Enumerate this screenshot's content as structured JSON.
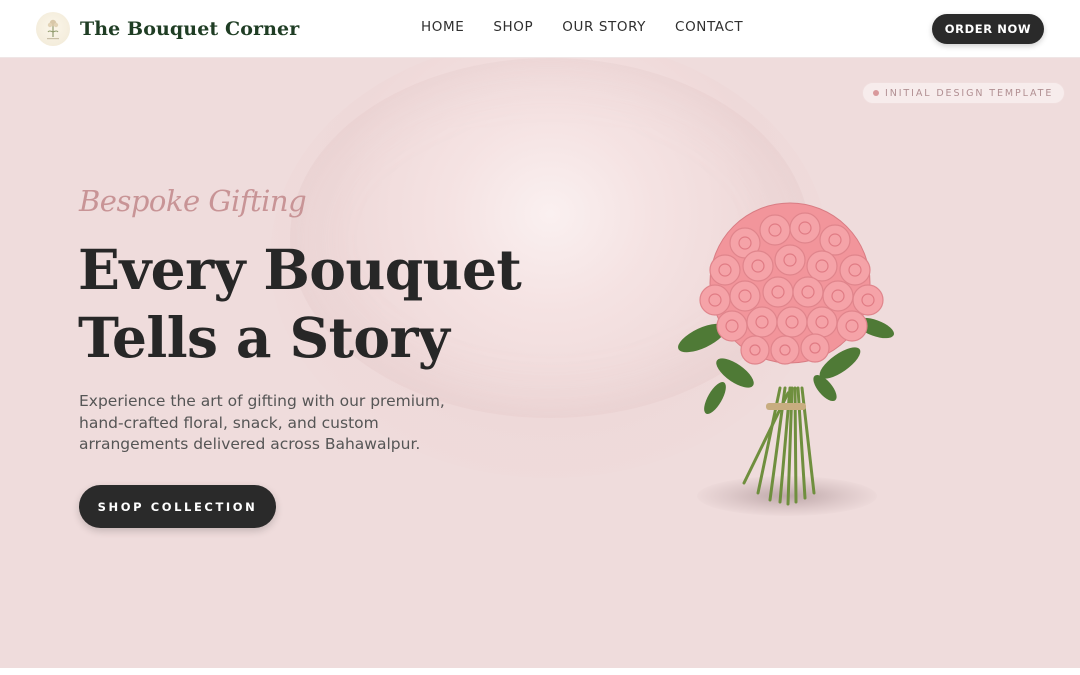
{
  "header": {
    "brand_name": "The Bouquet Corner",
    "logo_icon": "flower-logo-icon",
    "nav": [
      "HOME",
      "SHOP",
      "OUR STORY",
      "CONTACT"
    ],
    "order_button": "ORDER NOW"
  },
  "hero": {
    "badge": "INITIAL DESIGN TEMPLATE",
    "tagline": "Bespoke Gifting",
    "headline": "Every Bouquet Tells a Story",
    "description": "Experience the art of gifting with our premium, hand-crafted floral, snack, and custom arrangements delivered across Bahawalpur.",
    "cta_button": "SHOP COLLECTION",
    "image_subject": "pink-rose-bouquet"
  },
  "colors": {
    "hero_background": "#efdcdc",
    "brand_green": "#1f3d24",
    "button_dark": "#2a2a2a",
    "accent_pink": "#c89496"
  }
}
